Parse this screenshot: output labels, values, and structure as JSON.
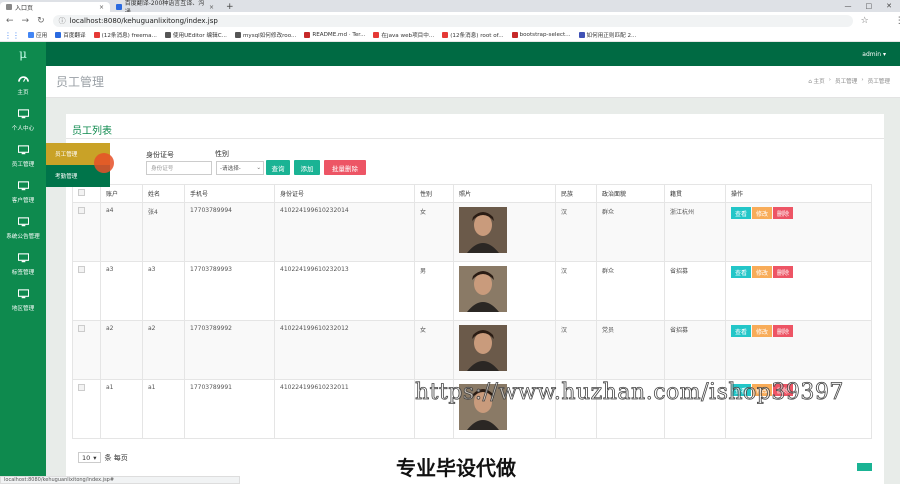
{
  "browser": {
    "tabs": [
      {
        "label": "入口页"
      },
      {
        "label": "百度翻译-200种语言互译、沟通"
      }
    ],
    "url": "localhost:8080/kehuguanlixitong/index.jsp",
    "bookmarks": [
      {
        "label": "应用",
        "color": "#4285f4"
      },
      {
        "label": "百度翻译",
        "color": "#2a6ae0"
      },
      {
        "label": "(12条消息) freema...",
        "color": "#e53935"
      },
      {
        "label": "使用UEditor 编辑C...",
        "color": "#555555"
      },
      {
        "label": "mysql如何修改roo...",
        "color": "#555555"
      },
      {
        "label": "README.md · Ter...",
        "color": "#c62828"
      },
      {
        "label": "在java web项目中...",
        "color": "#e53935"
      },
      {
        "label": "(12条消息) root of...",
        "color": "#e53935"
      },
      {
        "label": "bootstrap-select...",
        "color": "#c62828"
      },
      {
        "label": "如何用正则匹配 2...",
        "color": "#3f51b5"
      }
    ]
  },
  "sidebar": {
    "logo": "μ",
    "items": [
      {
        "label": "主页",
        "icon": "dashboard-icon"
      },
      {
        "label": "个人中心",
        "icon": "monitor-icon"
      },
      {
        "label": "员工管理",
        "icon": "monitor-icon"
      },
      {
        "label": "客户管理",
        "icon": "monitor-icon"
      },
      {
        "label": "系统公告管理",
        "icon": "monitor-icon"
      },
      {
        "label": "标签管理",
        "icon": "monitor-icon"
      },
      {
        "label": "地区管理",
        "icon": "monitor-icon"
      }
    ],
    "submenu": {
      "item1": "员工管理",
      "item2": "考勤管理"
    }
  },
  "topbar": {
    "user": "admin ▾"
  },
  "page": {
    "title": "员工管理",
    "breadcrumb": [
      "⌂ 主页",
      "›",
      "员工管理",
      "›",
      "员工管理"
    ]
  },
  "card": {
    "title": "员工列表",
    "filters": {
      "idcard_label": "身份证号",
      "idcard_placeholder": "身份证号",
      "gender_label": "性别",
      "gender_value": "-请选择-"
    },
    "buttons": {
      "search": "查询",
      "add": "添加",
      "batch_delete": "批量删除"
    }
  },
  "table": {
    "headers": [
      "账户",
      "姓名",
      "手机号",
      "身份证号",
      "性别",
      "照片",
      "民族",
      "政治面貌",
      "籍贯",
      "操作"
    ],
    "rows": [
      {
        "account": "a4",
        "name": "张4",
        "phone": "17703789994",
        "idcard": "410224199610232014",
        "gender": "女",
        "nation": "汉",
        "politics": "群众",
        "origin": "浙江杭州"
      },
      {
        "account": "a3",
        "name": "a3",
        "phone": "17703789993",
        "idcard": "410224199610232013",
        "gender": "男",
        "nation": "汉",
        "politics": "群众",
        "origin": "省招募"
      },
      {
        "account": "a2",
        "name": "a2",
        "phone": "17703789992",
        "idcard": "410224199610232012",
        "gender": "女",
        "nation": "汉",
        "politics": "党员",
        "origin": "省招募"
      },
      {
        "account": "a1",
        "name": "a1",
        "phone": "17703789991",
        "idcard": "410224199610232011",
        "gender": "",
        "nation": "",
        "politics": "",
        "origin": ""
      }
    ],
    "actions": {
      "view": "查看",
      "edit": "修改",
      "delete": "删除"
    }
  },
  "pager": {
    "size": "10",
    "suffix": "条 每页"
  },
  "overlay": {
    "watermark": "https://www.huzhan.com/ishop39397",
    "banner": "专业毕设代做"
  },
  "status_text": "localhost:8080/kehuguanlixitong/index.jsp#"
}
